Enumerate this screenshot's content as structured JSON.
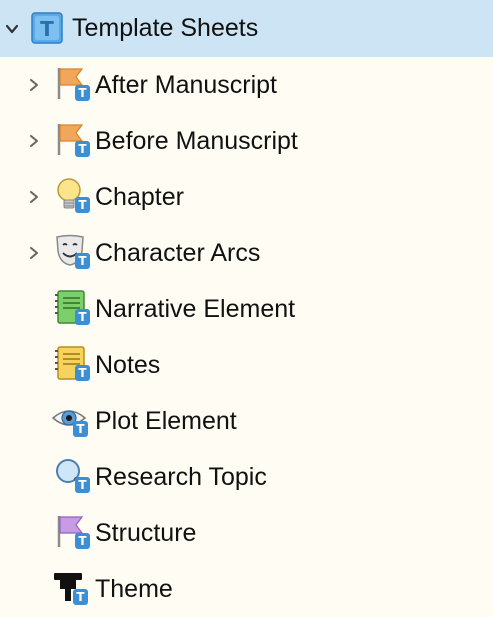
{
  "tree": {
    "root": {
      "label": "Template Sheets",
      "expanded": true,
      "icon": "template-folder-icon"
    },
    "items": [
      {
        "label": "After Manuscript",
        "icon": "orange-flag-icon",
        "has_children": true
      },
      {
        "label": "Before Manuscript",
        "icon": "orange-flag-icon",
        "has_children": true
      },
      {
        "label": "Chapter",
        "icon": "lightbulb-icon",
        "has_children": true
      },
      {
        "label": "Character Arcs",
        "icon": "theater-mask-icon",
        "has_children": true
      },
      {
        "label": "Narrative Element",
        "icon": "green-notebook-icon",
        "has_children": false
      },
      {
        "label": "Notes",
        "icon": "yellow-notebook-icon",
        "has_children": false
      },
      {
        "label": "Plot Element",
        "icon": "eye-icon",
        "has_children": false
      },
      {
        "label": "Research Topic",
        "icon": "magnifier-icon",
        "has_children": false
      },
      {
        "label": "Structure",
        "icon": "purple-flag-icon",
        "has_children": false
      },
      {
        "label": "Theme",
        "icon": "black-hat-icon",
        "has_children": false
      }
    ],
    "badge_letter": "T",
    "colors": {
      "background": "#fffdf3",
      "selected_row": "#cce4f4",
      "template_badge": "#3a8fd6"
    }
  }
}
